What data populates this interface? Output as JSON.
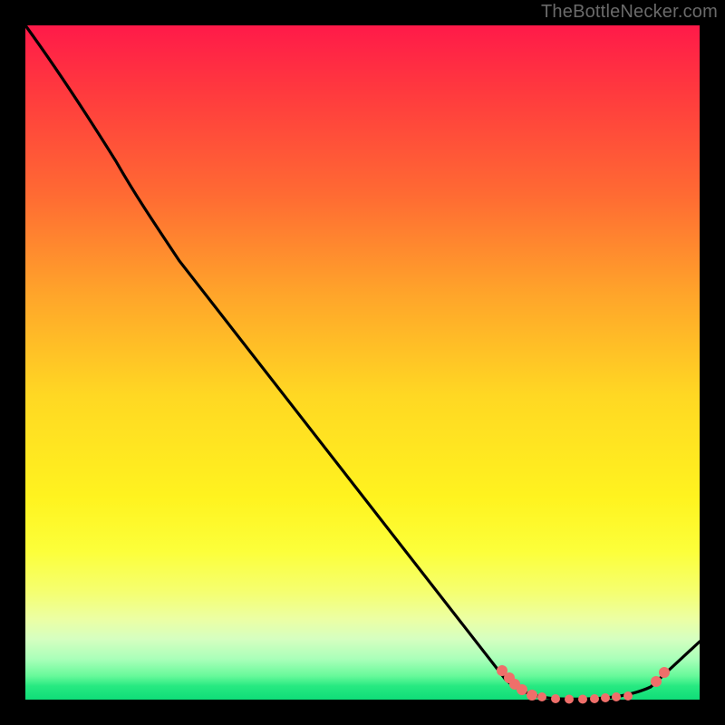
{
  "watermark": "TheBottleNecker.com",
  "chart_data": {
    "type": "line",
    "title": "",
    "xlabel": "",
    "ylabel": "",
    "xlim": [
      0,
      100
    ],
    "ylim": [
      0,
      100
    ],
    "background_gradient": {
      "orientation": "vertical",
      "stops": [
        {
          "pos": 0.0,
          "color": "#ff1a49"
        },
        {
          "pos": 0.25,
          "color": "#ff6a33"
        },
        {
          "pos": 0.55,
          "color": "#ffd823"
        },
        {
          "pos": 0.78,
          "color": "#fcff3a"
        },
        {
          "pos": 0.94,
          "color": "#a9ffb9"
        },
        {
          "pos": 1.0,
          "color": "#0fdd78"
        }
      ]
    },
    "series": [
      {
        "name": "bottleneck-curve",
        "color": "#000000",
        "x": [
          0,
          6,
          12,
          18,
          24,
          30,
          36,
          42,
          48,
          54,
          60,
          66,
          72,
          78,
          82,
          86,
          90,
          94,
          100
        ],
        "y": [
          100,
          92,
          84,
          77,
          69,
          61,
          53,
          45,
          37,
          29,
          21,
          13,
          5,
          1,
          0,
          0,
          1,
          3,
          9
        ]
      }
    ],
    "markers": {
      "name": "valley-dots",
      "color": "#ef6f6a",
      "x": [
        71,
        72,
        73,
        74,
        75,
        77,
        79,
        81,
        83,
        85,
        87,
        88,
        89,
        94,
        95
      ],
      "y": [
        4.3,
        3.2,
        2.3,
        1.5,
        0.7,
        0.4,
        0.1,
        0.07,
        0.07,
        0.13,
        0.27,
        0.4,
        0.54,
        2.7,
        4.0
      ]
    }
  }
}
